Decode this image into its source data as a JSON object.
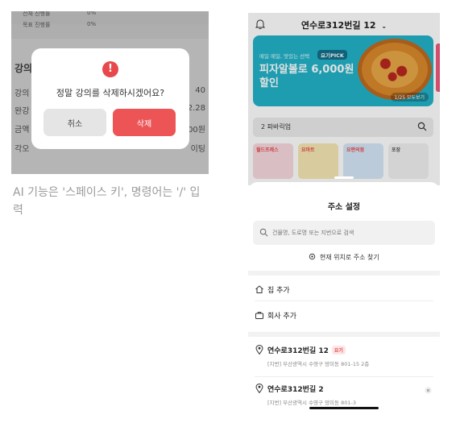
{
  "left_screen": {
    "background_rows": [
      {
        "label": "전체 진행률",
        "value": "0%"
      },
      {
        "label": "목표 진행률",
        "value": "0%"
      }
    ],
    "background_heading": "강의",
    "background_items": [
      {
        "left": "강의",
        "right": "40"
      },
      {
        "left": "완강",
        "right": "2.28"
      },
      {
        "left": "금액",
        "right": "00원"
      },
      {
        "left": "각오",
        "right": "이팅"
      }
    ],
    "dialog": {
      "icon": "exclamation-icon",
      "icon_glyph": "!",
      "message": "정말 강의를 삭제하시겠어요?",
      "cancel_label": "취소",
      "delete_label": "삭제"
    },
    "caption": "AI 기능은 '스페이스 키', 명령어는 '/' 입력"
  },
  "phone": {
    "location_title": "연수로312번길 12",
    "banner": {
      "subtitle": "매일 매일, 맛있는 선택",
      "pick_label": "요기PICK",
      "title": "피자알볼로 6,000원 할인",
      "counter": "1/25 모두보기"
    },
    "search_text": "2  파바릭업",
    "categories": [
      {
        "label": "월드프레스",
        "color": "#f7d9de"
      },
      {
        "label": "요마트",
        "color": "#f6e7b3"
      },
      {
        "label": "요편의점",
        "color": "#d7e8f7"
      },
      {
        "label": "포장",
        "color": "#f1f1f1"
      }
    ],
    "sheet": {
      "title": "주소 설정",
      "search_placeholder": "건물명, 도로명 또는 지번으로 검색",
      "current_location": "현재 위치로 주소 찾기",
      "add_home": "집 추가",
      "add_work": "회사 추가",
      "addresses": [
        {
          "title": "연수로312번길 12",
          "badge": "요기",
          "detail": "[지번] 부산광역시 수영구 망미동 801-15 2층"
        },
        {
          "title": "연수로312번길 2",
          "badge": "",
          "detail": "[지번] 부산광역시 수영구 망미동 801-3"
        }
      ]
    }
  },
  "colors": {
    "accent_red": "#ec5455",
    "banner_teal": "#23b3c9"
  }
}
